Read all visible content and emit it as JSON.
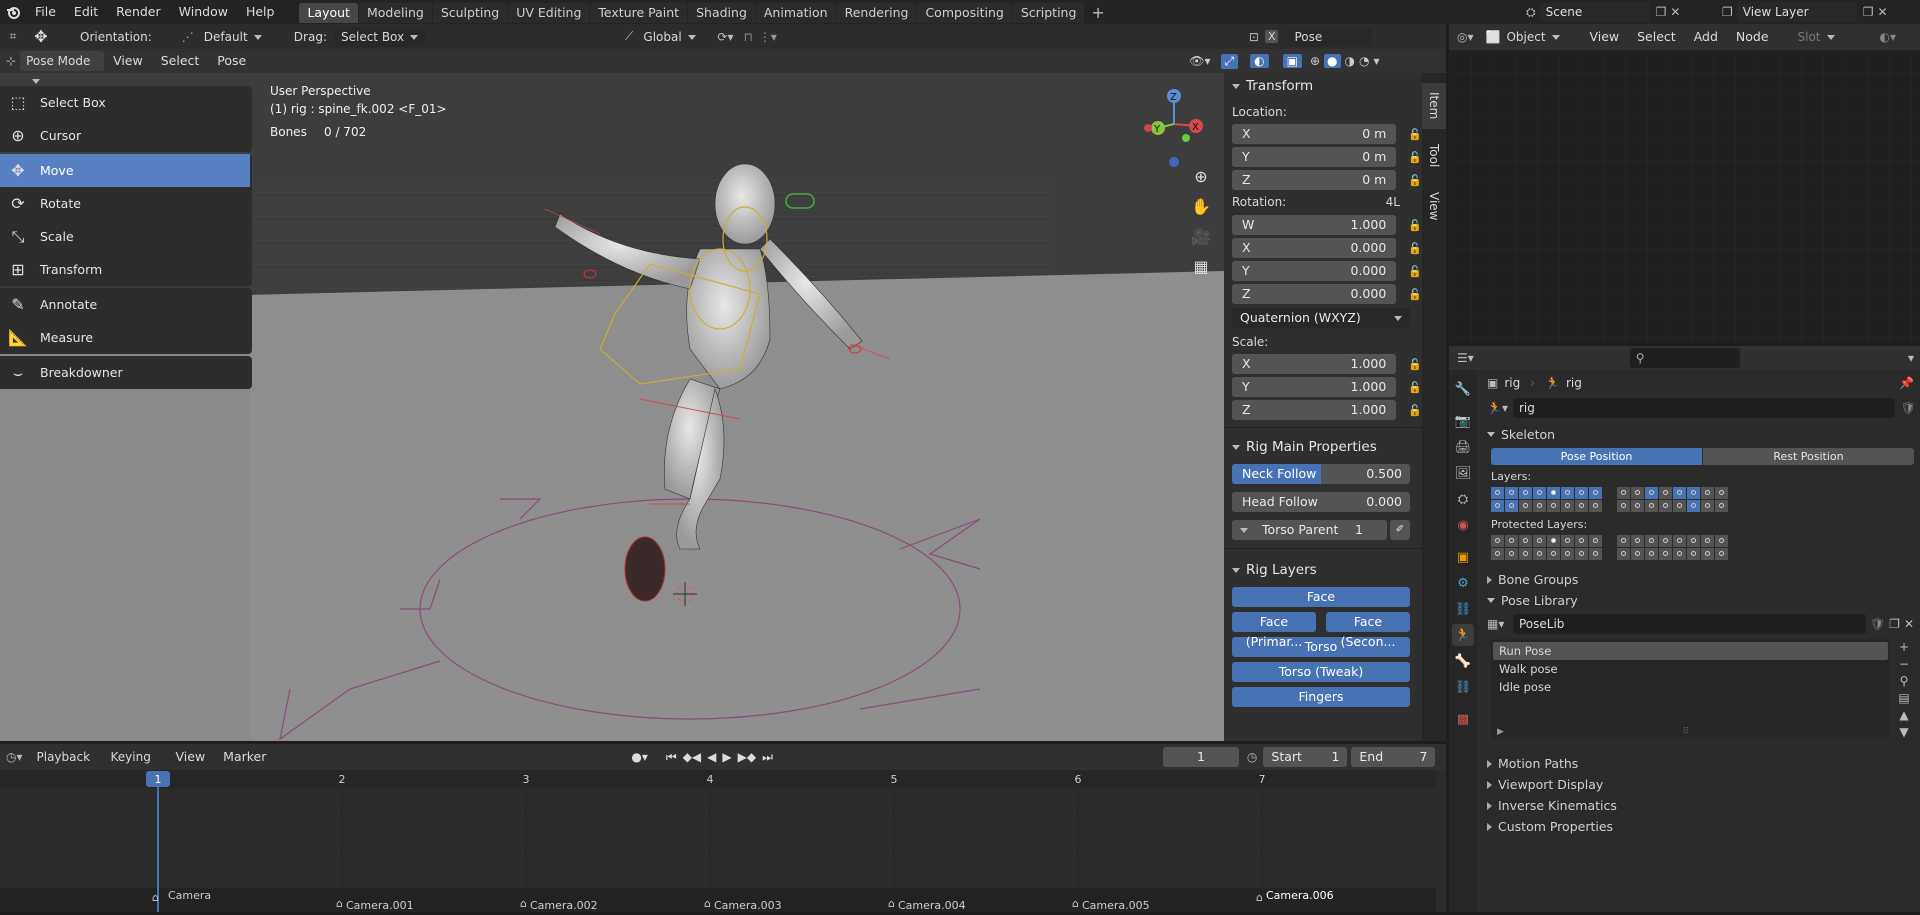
{
  "menubar": {
    "items": [
      "File",
      "Edit",
      "Render",
      "Window",
      "Help"
    ]
  },
  "workspaces": {
    "tabs": [
      "Layout",
      "Modeling",
      "Sculpting",
      "UV Editing",
      "Texture Paint",
      "Shading",
      "Animation",
      "Rendering",
      "Compositing",
      "Scripting"
    ],
    "active": "Layout"
  },
  "scene": {
    "name": "Scene",
    "view_layer": "View Layer"
  },
  "tool_header": {
    "orientation_label": "Orientation:",
    "orientation": "Default",
    "drag_label": "Drag:",
    "drag": "Select Box",
    "transform_orientation": "Global",
    "pose_options": "Pose Options"
  },
  "viewport_header": {
    "mode": "Pose Mode",
    "menus": [
      "View",
      "Select",
      "Pose"
    ]
  },
  "viewport": {
    "perspective": "User Perspective",
    "object_info": "(1) rig : spine_fk.002 <F_01>",
    "bones_label": "Bones",
    "bones_value": "0 / 702"
  },
  "toolbar": {
    "tools": [
      "Select Box",
      "Cursor",
      "Move",
      "Rotate",
      "Scale",
      "Transform",
      "Annotate",
      "Measure",
      "Breakdowner"
    ],
    "active": "Move"
  },
  "nav_gizmo": {
    "z": "Z",
    "y": "Y",
    "x": "X"
  },
  "n_panel": {
    "tabs": [
      "Item",
      "Tool",
      "View"
    ],
    "transform": {
      "title": "Transform",
      "location_label": "Location:",
      "location": [
        {
          "axis": "X",
          "value": "0 m"
        },
        {
          "axis": "Y",
          "value": "0 m"
        },
        {
          "axis": "Z",
          "value": "0 m"
        }
      ],
      "rotation_label": "Rotation:",
      "rotation_mode_badge": "4L",
      "rotation": [
        {
          "axis": "W",
          "value": "1.000"
        },
        {
          "axis": "X",
          "value": "0.000"
        },
        {
          "axis": "Y",
          "value": "0.000"
        },
        {
          "axis": "Z",
          "value": "0.000"
        }
      ],
      "rotation_mode": "Quaternion (WXYZ)",
      "scale_label": "Scale:",
      "scale": [
        {
          "axis": "X",
          "value": "1.000"
        },
        {
          "axis": "Y",
          "value": "1.000"
        },
        {
          "axis": "Z",
          "value": "1.000"
        }
      ]
    },
    "rig_main": {
      "title": "Rig Main Properties",
      "neck_follow_label": "Neck Follow",
      "neck_follow": "0.500",
      "neck_follow_fraction": 0.5,
      "head_follow_label": "Head Follow",
      "head_follow": "0.000",
      "torso_parent_label": "Torso Parent",
      "torso_parent": "1"
    },
    "rig_layers": {
      "title": "Rig Layers",
      "face": "Face",
      "face_primary": "Face (Primar...",
      "face_secondary": "Face (Secon...",
      "torso": "Torso",
      "torso_tweak": "Torso (Tweak)",
      "fingers": "Fingers"
    }
  },
  "node_editor": {
    "type": "Object",
    "menus": [
      "View",
      "Select",
      "Add",
      "Node"
    ],
    "slot": "Slot"
  },
  "properties": {
    "breadcrumb": [
      "rig",
      "rig"
    ],
    "data_name": "rig",
    "skeleton": {
      "title": "Skeleton",
      "pose_position": "Pose Position",
      "rest_position": "Rest Position",
      "layers_label": "Layers:",
      "protected_label": "Protected Layers:"
    },
    "panels_collapsed_top": [
      "Bone Groups"
    ],
    "pose_library": {
      "title": "Pose Library",
      "name": "PoseLib",
      "poses": [
        "Run Pose",
        "Walk pose",
        "Idle pose"
      ],
      "active": "Run Pose"
    },
    "panels_collapsed_bottom": [
      "Motion Paths",
      "Viewport Display",
      "Inverse Kinematics",
      "Custom Properties"
    ]
  },
  "timeline": {
    "menus": [
      "Playback",
      "Keying",
      "View",
      "Marker"
    ],
    "current_frame": "1",
    "start_label": "Start",
    "start": "1",
    "end_label": "End",
    "end": "7",
    "frames": [
      "1",
      "2",
      "3",
      "4",
      "5",
      "6",
      "7"
    ],
    "markers": [
      "Camera",
      "Camera.001",
      "Camera.002",
      "Camera.003",
      "Camera.004",
      "Camera.005",
      "Camera.006"
    ]
  },
  "colors": {
    "accent": "#4772b3",
    "active_tool": "#5680c2",
    "viewport_bg": "#3d3d3d",
    "floor": "#8e8e8e",
    "panel": "#303030",
    "playhead": "#4772b3"
  }
}
